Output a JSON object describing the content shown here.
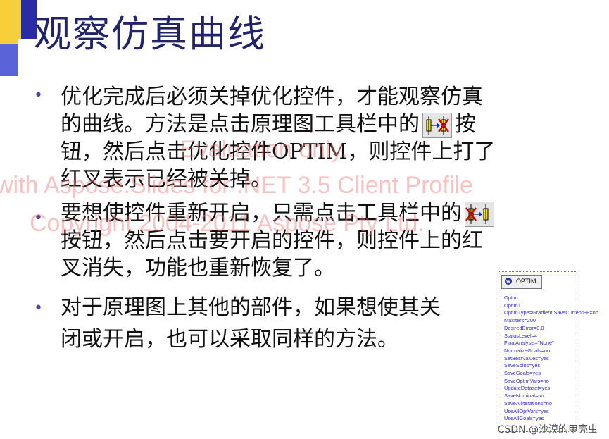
{
  "title": "观察仿真曲线",
  "bullets": [
    {
      "lines": [
        "优化完成后必须关掉优化控件，才能观察仿真",
        "的曲线。方法是点击原理图工具栏中的",
        "按",
        "钮，然后点击优化控件OPTIM，则控件上打了",
        "红叉表示已经被关掉。"
      ]
    },
    {
      "lines": [
        "要想使控件重新开启，只需点击工具栏中的",
        "按钮，然后点击要开启的控件，则控件上的红",
        "叉消失，功能也重新恢复了。"
      ]
    },
    {
      "lines": [
        "对于原理图上其他的部件，如果想使其关",
        "闭或开启，也可以采取同样的方法。"
      ]
    }
  ],
  "icons": {
    "deactivate": "deactivate-component-icon",
    "activate": "activate-component-icon"
  },
  "watermark": {
    "line1": "Evaluation only.",
    "line2": "with Aspose.Slides for .NET 3.5 Client Profile",
    "line3": "Copyright 2004-2011 Aspose Pty Ltd."
  },
  "optim_panel": {
    "header": "OPTIM",
    "lines": [
      "Optim",
      "Optim1",
      "OptimType=Gradient  SaveCurrentEF=no",
      "MaxIters=200",
      "DesiredError=0.0",
      "StatusLevel=4",
      "FinalAnalysis=\"None\"",
      "NormalizeGoals=no",
      "SetBestValues=yes",
      "SaveSolns=yes",
      "SaveGoals=yes",
      "SaveOptimVars=no",
      "UpdateDataset=yes",
      "SaveNominal=no",
      "SaveAllIterations=no",
      "UseAllOptVars=yes",
      "UseAllGoals=yes"
    ]
  },
  "credit": "CSDN @沙漠的甲壳虫",
  "colors": {
    "title": "#22246b",
    "deco_yellow": "#f6cf3a",
    "deco_blue": "#2a2ca6",
    "watermark": "#eb7878"
  }
}
